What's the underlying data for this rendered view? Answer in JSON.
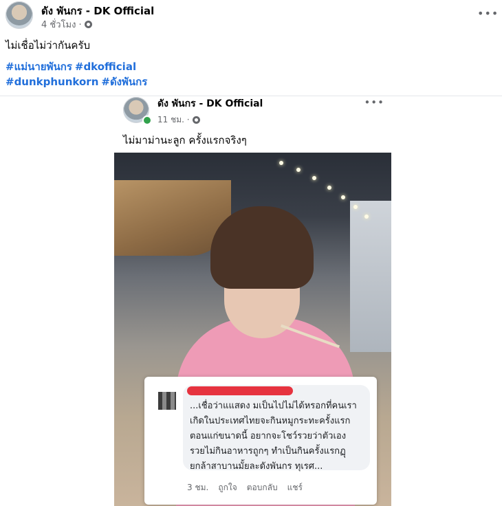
{
  "post": {
    "author": "ดัง พันกร - DK Official",
    "time": "4 ชั่วโมง ·",
    "caption": "ไม่เชื่อไม่ว่ากันครับ",
    "hashtags": [
      "#แม่นายพันกร",
      "#dkofficial",
      "#dunkphunkorn",
      "#ดังพันกร"
    ],
    "more": "•••"
  },
  "embedded": {
    "author": "ดัง พันกร - DK Official",
    "time": "11 ชม. ·",
    "caption": "ไม่มาม่านะลูก ครั้งแรกจริงๆ",
    "more": "•••",
    "comment": {
      "text": "...เชื่อว่าแแสดง มเป็นไปไม่ได้หรอกที่คนเรา\nเกิดในประเทศไทยจะกินหมูกระทะครั้งแรก\nตอนแก่ขนาดนี้ อยากจะโชว์รวยว่าตัวเอง\nรวยไม่กินอาหารถูกๆ ทำเป็นกินครั้งแรกฏุ\nยกล้าสาบานมั้ยละดังพันกร ทุเรศ...",
      "age": "3 ชม.",
      "like": "ถูกใจ",
      "reply": "ตอบกลับ",
      "share": "แชร์"
    }
  }
}
